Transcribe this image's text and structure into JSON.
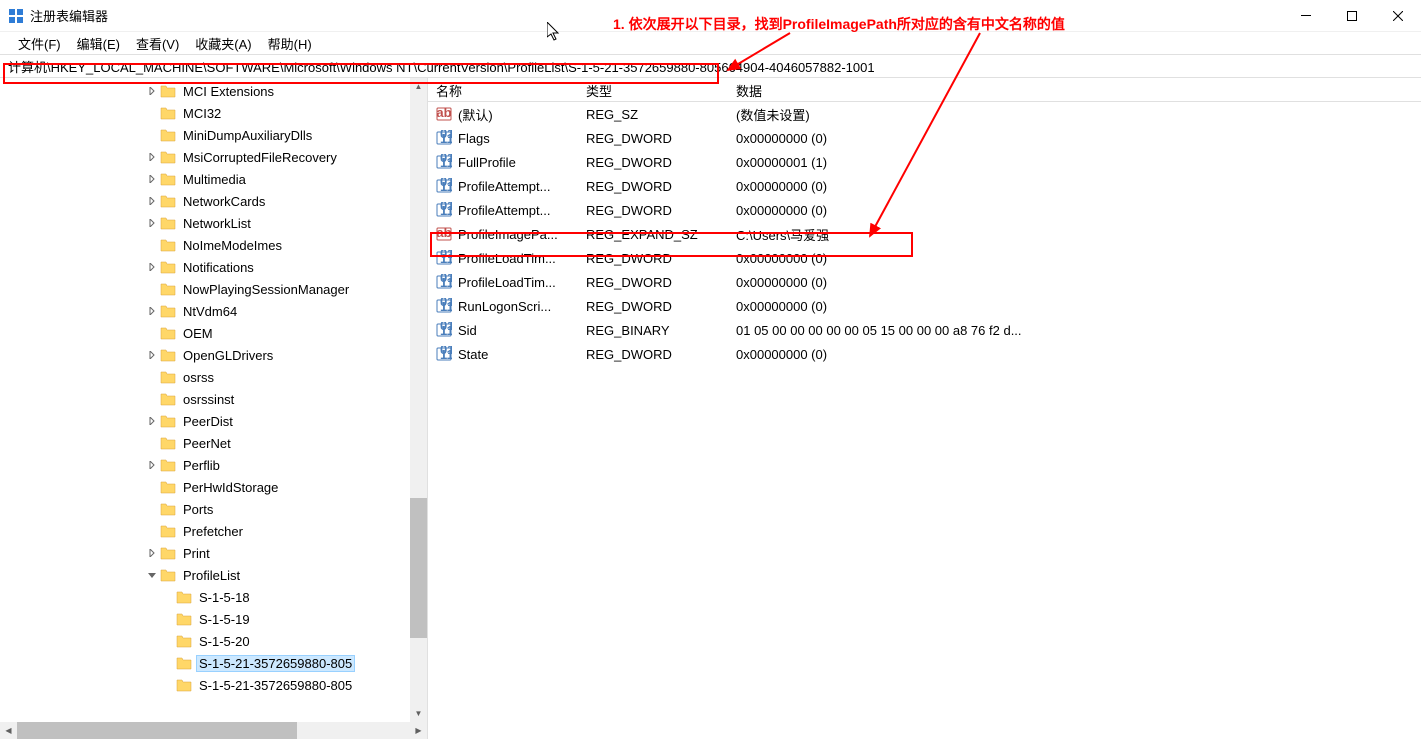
{
  "window": {
    "title": "注册表编辑器"
  },
  "menubar": {
    "file": "文件(F)",
    "edit": "编辑(E)",
    "view": "查看(V)",
    "favorites": "收藏夹(A)",
    "help": "帮助(H)"
  },
  "addressbar": {
    "path": "计算机\\HKEY_LOCAL_MACHINE\\SOFTWARE\\Microsoft\\Windows NT\\CurrentVersion\\ProfileList\\S-1-5-21-3572659880-805664904-4046057882-1001"
  },
  "tree": {
    "items": [
      {
        "indent": 9,
        "expand": ">",
        "label": "MCI Extensions"
      },
      {
        "indent": 9,
        "expand": "",
        "label": "MCI32"
      },
      {
        "indent": 9,
        "expand": "",
        "label": "MiniDumpAuxiliaryDlls"
      },
      {
        "indent": 9,
        "expand": ">",
        "label": "MsiCorruptedFileRecovery"
      },
      {
        "indent": 9,
        "expand": ">",
        "label": "Multimedia"
      },
      {
        "indent": 9,
        "expand": ">",
        "label": "NetworkCards"
      },
      {
        "indent": 9,
        "expand": ">",
        "label": "NetworkList"
      },
      {
        "indent": 9,
        "expand": "",
        "label": "NoImeModeImes"
      },
      {
        "indent": 9,
        "expand": ">",
        "label": "Notifications"
      },
      {
        "indent": 9,
        "expand": "",
        "label": "NowPlayingSessionManager"
      },
      {
        "indent": 9,
        "expand": ">",
        "label": "NtVdm64"
      },
      {
        "indent": 9,
        "expand": "",
        "label": "OEM"
      },
      {
        "indent": 9,
        "expand": ">",
        "label": "OpenGLDrivers"
      },
      {
        "indent": 9,
        "expand": "",
        "label": "osrss"
      },
      {
        "indent": 9,
        "expand": "",
        "label": "osrssinst"
      },
      {
        "indent": 9,
        "expand": ">",
        "label": "PeerDist"
      },
      {
        "indent": 9,
        "expand": "",
        "label": "PeerNet"
      },
      {
        "indent": 9,
        "expand": ">",
        "label": "Perflib"
      },
      {
        "indent": 9,
        "expand": "",
        "label": "PerHwIdStorage"
      },
      {
        "indent": 9,
        "expand": "",
        "label": "Ports"
      },
      {
        "indent": 9,
        "expand": "",
        "label": "Prefetcher"
      },
      {
        "indent": 9,
        "expand": ">",
        "label": "Print"
      },
      {
        "indent": 9,
        "expand": "v",
        "label": "ProfileList"
      },
      {
        "indent": 10,
        "expand": "",
        "label": "S-1-5-18"
      },
      {
        "indent": 10,
        "expand": "",
        "label": "S-1-5-19"
      },
      {
        "indent": 10,
        "expand": "",
        "label": "S-1-5-20"
      },
      {
        "indent": 10,
        "expand": "",
        "label": "S-1-5-21-3572659880-805",
        "selected": true
      },
      {
        "indent": 10,
        "expand": "",
        "label": "S-1-5-21-3572659880-805"
      }
    ]
  },
  "list": {
    "headers": {
      "name": "名称",
      "type": "类型",
      "data": "数据"
    },
    "rows": [
      {
        "icon": "string",
        "name": "(默认)",
        "type": "REG_SZ",
        "data": "(数值未设置)"
      },
      {
        "icon": "dword",
        "name": "Flags",
        "type": "REG_DWORD",
        "data": "0x00000000 (0)"
      },
      {
        "icon": "dword",
        "name": "FullProfile",
        "type": "REG_DWORD",
        "data": "0x00000001 (1)"
      },
      {
        "icon": "dword",
        "name": "ProfileAttempt...",
        "type": "REG_DWORD",
        "data": "0x00000000 (0)"
      },
      {
        "icon": "dword",
        "name": "ProfileAttempt...",
        "type": "REG_DWORD",
        "data": "0x00000000 (0)"
      },
      {
        "icon": "string",
        "name": "ProfileImagePa...",
        "type": "REG_EXPAND_SZ",
        "data": "C:\\Users\\马爱强"
      },
      {
        "icon": "dword",
        "name": "ProfileLoadTim...",
        "type": "REG_DWORD",
        "data": "0x00000000 (0)"
      },
      {
        "icon": "dword",
        "name": "ProfileLoadTim...",
        "type": "REG_DWORD",
        "data": "0x00000000 (0)"
      },
      {
        "icon": "dword",
        "name": "RunLogonScri...",
        "type": "REG_DWORD",
        "data": "0x00000000 (0)"
      },
      {
        "icon": "dword",
        "name": "Sid",
        "type": "REG_BINARY",
        "data": "01 05 00 00 00 00 00 05 15 00 00 00 a8 76 f2 d..."
      },
      {
        "icon": "dword",
        "name": "State",
        "type": "REG_DWORD",
        "data": "0x00000000 (0)"
      }
    ]
  },
  "annotation": {
    "text": "1. 依次展开以下目录，找到ProfileImagePath所对应的含有中文名称的值"
  }
}
